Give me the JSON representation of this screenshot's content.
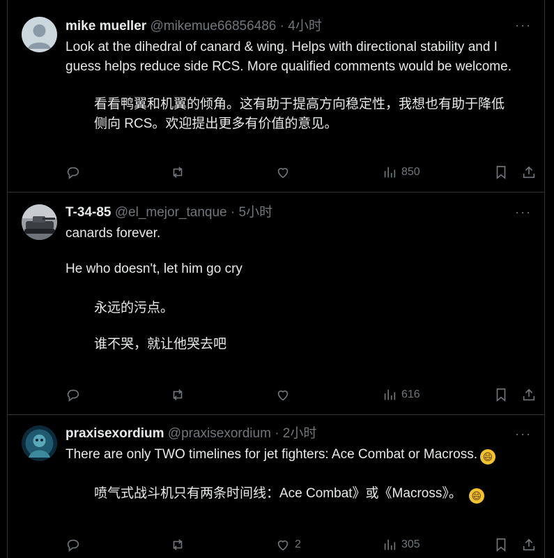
{
  "tweets": [
    {
      "name": "mike mueller",
      "handle": "@mikemue66856486",
      "sep": "·",
      "time": "4小时",
      "more": "···",
      "text": "Look at the dihedral of canard & wing. Helps with directional stability and I guess helps reduce side RCS. More qualified comments would be welcome.",
      "translation": "看看鸭翼和机翼的倾角。这有助于提高方向稳定性，我想也有助于降低侧向 RCS。欢迎提出更多有价值的意见。",
      "likes": "",
      "views": "850"
    },
    {
      "name": "T-34-85",
      "handle": "@el_mejor_tanque",
      "sep": "·",
      "time": "5小时",
      "more": "···",
      "text_line1": "canards forever.",
      "text_line2": "He who doesn't, let him go cry",
      "translation_line1": "永远的污点。",
      "translation_line2": "谁不哭，就让他哭去吧",
      "likes": "",
      "views": "616"
    },
    {
      "name": "praxisexordium",
      "handle": "@praxisexordium",
      "sep": "·",
      "time": "2小时",
      "more": "···",
      "text": "There are only TWO timelines for jet fighters: Ace Combat or Macross.",
      "translation": "喷气式战斗机只有两条时间线：Ace Combat》或《Macross》。",
      "emoji": "😄",
      "likes": "2",
      "views": "305"
    }
  ],
  "icons": [
    "reply-icon",
    "retweet-icon",
    "like-icon",
    "views-icon",
    "bookmark-icon",
    "share-icon",
    "more-icon"
  ],
  "colors": {
    "background": "#000000",
    "text": "#e7e9ea",
    "muted": "#71767b",
    "border": "#2f3336"
  }
}
